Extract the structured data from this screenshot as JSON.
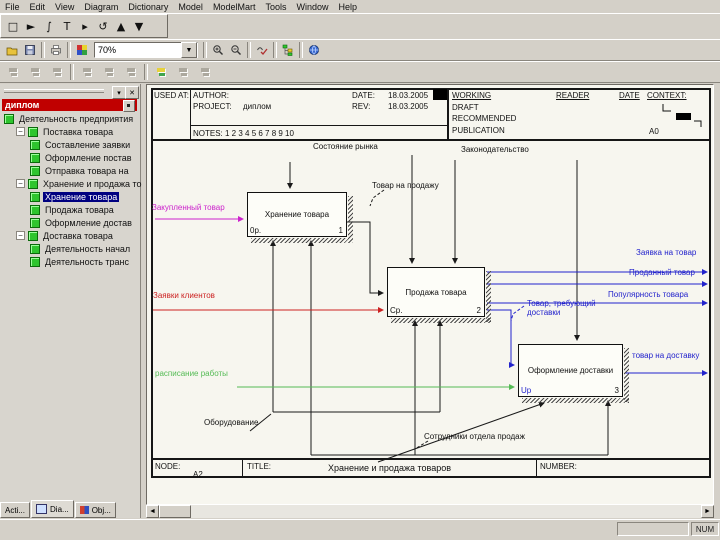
{
  "menu": {
    "items": [
      "File",
      "Edit",
      "View",
      "Diagram",
      "Dictionary",
      "Model",
      "ModelMart",
      "Tools",
      "Window",
      "Help"
    ]
  },
  "toolbox": {
    "tools": [
      {
        "name": "activity-box-tool",
        "glyph": "□"
      },
      {
        "name": "arrow-tool",
        "glyph": "►"
      },
      {
        "name": "squiggle-tool",
        "glyph": "∫"
      },
      {
        "name": "text-tool",
        "glyph": "T"
      },
      {
        "name": "goto-child-tool",
        "glyph": "▸"
      },
      {
        "name": "rotate-tool",
        "glyph": "↺"
      },
      {
        "name": "goto-parent-tool",
        "glyph": "▲"
      },
      {
        "name": "goto-sibling-tool",
        "glyph": "▼"
      }
    ]
  },
  "toolbar": {
    "zoom_value": "70%"
  },
  "explorer": {
    "panel_title": "диплом",
    "tree": [
      {
        "label": "Деятельность предприятия",
        "level": 0,
        "expander": "",
        "selected": false
      },
      {
        "label": "Поставка товара",
        "level": 1,
        "expander": "-",
        "selected": false
      },
      {
        "label": "Составление заявки",
        "level": 2,
        "expander": "",
        "selected": false
      },
      {
        "label": "Оформление постав",
        "level": 2,
        "expander": "",
        "selected": false
      },
      {
        "label": "Отправка товара на",
        "level": 2,
        "expander": "",
        "selected": false
      },
      {
        "label": "Хранение и продажа то",
        "level": 1,
        "expander": "-",
        "selected": false
      },
      {
        "label": "Хранение товара",
        "level": 2,
        "expander": "",
        "selected": true
      },
      {
        "label": "Продажа товара",
        "level": 2,
        "expander": "",
        "selected": false
      },
      {
        "label": "Оформление достав",
        "level": 2,
        "expander": "",
        "selected": false
      },
      {
        "label": "Доставка товара",
        "level": 1,
        "expander": "-",
        "selected": false
      },
      {
        "label": "Деятельность начал",
        "level": 2,
        "expander": "",
        "selected": false
      },
      {
        "label": "Деятельность транс",
        "level": 2,
        "expander": "",
        "selected": false
      }
    ],
    "tabs": [
      "Acti...",
      "Dia...",
      "Obj..."
    ]
  },
  "titleblock": {
    "used_at": "USED AT:",
    "author_label": "AUTHOR:",
    "date_label": "DATE:",
    "date": "18.03.2005",
    "rev_label": "REV:",
    "rev": "18.03.2005",
    "project_label": "PROJECT:",
    "project": "диплом",
    "notes": "NOTES:  1  2  3  4  5  6  7  8  9  10",
    "working": "WORKING",
    "draft": "DRAFT",
    "recommended": "RECOMMENDED",
    "publication": "PUBLICATION",
    "reader": "READER",
    "date2": "DATE",
    "context": "CONTEXT:",
    "context_node": "A0"
  },
  "diagram": {
    "boxes": [
      {
        "title": "Хранение товара",
        "cost": "0р.",
        "number": "1",
        "cost_color": "#111111"
      },
      {
        "title": "Продажа товара",
        "cost": "Ср.",
        "number": "2",
        "cost_color": "#111111"
      },
      {
        "title": "Оформление доставки",
        "cost": "Up",
        "number": "3",
        "cost_color": "#2222cc"
      }
    ],
    "labels": [
      {
        "id": "market-state",
        "text": "Состояние рынка",
        "color": "#111111"
      },
      {
        "id": "legislation",
        "text": "Законодательство",
        "color": "#111111"
      },
      {
        "id": "goods-for-sale",
        "text": "Товар на продажу",
        "color": "#111111"
      },
      {
        "id": "purchased-goods",
        "text": "Закупленный товар",
        "color": "#cc22cc"
      },
      {
        "id": "client-orders",
        "text": "Заявки клиентов",
        "color": "#cc2222"
      },
      {
        "id": "work-schedule",
        "text": "расписание работы",
        "color": "#55bb55"
      },
      {
        "id": "equipment",
        "text": "Оборудование",
        "color": "#111111"
      },
      {
        "id": "sales-staff",
        "text": "Сотрудники отдела продаж",
        "color": "#111111"
      },
      {
        "id": "goods-request",
        "text": "Заявка на товар",
        "color": "#2222cc"
      },
      {
        "id": "sold-goods",
        "text": "Проданный товар",
        "color": "#2222cc"
      },
      {
        "id": "goods-popularity",
        "text": "Популярность товара",
        "color": "#2222cc"
      },
      {
        "id": "goods-requiring-delivery",
        "text": "Товар, требующий доставки",
        "color": "#2222cc"
      },
      {
        "id": "goods-for-delivery",
        "text": "товар на доставку",
        "color": "#2222cc"
      }
    ]
  },
  "nodebar": {
    "node_label": "NODE:",
    "node": "A2",
    "title_label": "TITLE:",
    "title": "Хранение и продажа товаров",
    "number_label": "NUMBER:"
  },
  "statusbar": {
    "num": "NUM"
  }
}
